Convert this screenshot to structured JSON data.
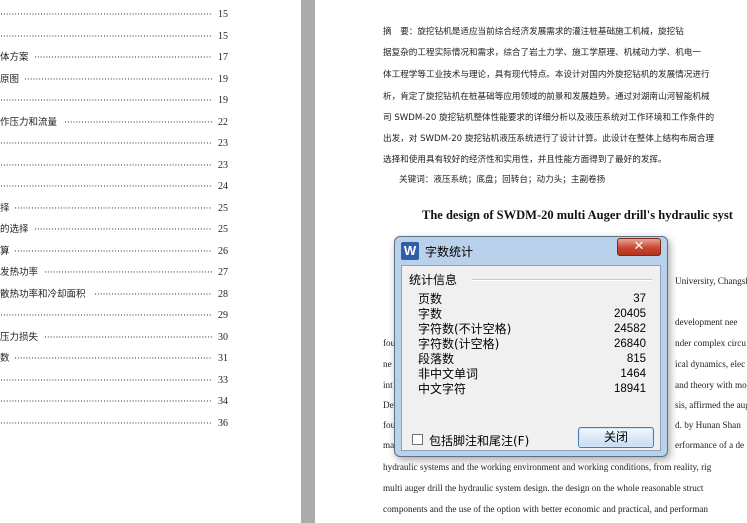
{
  "toc": [
    {
      "label": "",
      "page": "15"
    },
    {
      "label": "",
      "page": "15"
    },
    {
      "label": "体方案",
      "page": "17"
    },
    {
      "label": "原图",
      "page": "19"
    },
    {
      "label": "",
      "page": "19"
    },
    {
      "label": "作压力和流量",
      "page": "22"
    },
    {
      "label": "",
      "page": "23"
    },
    {
      "label": "",
      "page": "23"
    },
    {
      "label": "",
      "page": "24"
    },
    {
      "label": "择",
      "page": "25"
    },
    {
      "label": "的选择",
      "page": "25"
    },
    {
      "label": "算",
      "page": "26"
    },
    {
      "label": "发热功率",
      "page": "27"
    },
    {
      "label": "散热功率和冷却面积",
      "page": "28"
    },
    {
      "label": "",
      "page": "29"
    },
    {
      "label": "压力损失",
      "page": "30"
    },
    {
      "label": "数",
      "page": "31"
    },
    {
      "label": "",
      "page": "33"
    },
    {
      "label": "",
      "page": "34"
    },
    {
      "label": "",
      "page": "36"
    }
  ],
  "abstract_cn": [
    "摘　要：旋挖钻机是适应当前综合经济发展需求的灌注桩基础施工机械，旋挖钻",
    "据复杂的工程实际情况和需求，综合了岩土力学、施工学原理、机械动力学、机电一",
    "体工程学等工业技术与理论，具有现代特点。本设计对国内外旋挖钻机的发展情况进行",
    "析，肯定了旋挖钻机在桩基础等应用领域的前景和发展趋势。通过对湖南山河智能机械",
    "司 SWDM-20 旋挖钻机整体性能要求的详细分析以及液压系统对工作环境和工作条件的",
    "出发，对 SWDM-20 旋挖钻机液压系统进行了设计计算。此设计在整体上结构布局合理",
    "选择和使用具有较好的经济性和实用性，并且性能方面得到了最好的发挥。"
  ],
  "keywords_cn": "关键词：液压系统；底盘；回转台；动力头；主副卷扬",
  "title_en": "The design of SWDM-20 multi Auger drill's hydraulic syst",
  "abstract_en_right_fragments": [
    "University, Changsh",
    "development nee",
    "nder complex circu",
    "ical dynamics, elec",
    "and theory with mo",
    "sis, affirmed the aug",
    "d. by Hunan Shan",
    "erformance of a de"
  ],
  "abstract_en_left_fragments": [
    "fou",
    "ne",
    "int",
    "De",
    "fou",
    "ma"
  ],
  "abstract_en_bottom": [
    "hydraulic systems and the working environment and working conditions, from reality, rig",
    "multi auger drill the hydraulic system design. the design on the whole reasonable struct",
    "components and the use of the option with better economic and practical, and performan"
  ],
  "dialog": {
    "icon_letter": "W",
    "title": "字数统计",
    "close_glyph": "✕",
    "section_label": "统计信息",
    "stats": [
      {
        "label": "页数",
        "value": "37"
      },
      {
        "label": "字数",
        "value": "20405"
      },
      {
        "label": "字符数(不计空格)",
        "value": "24582"
      },
      {
        "label": "字符数(计空格)",
        "value": "26840"
      },
      {
        "label": "段落数",
        "value": "815"
      },
      {
        "label": "非中文单词",
        "value": "1464"
      },
      {
        "label": "中文字符",
        "value": "18941"
      }
    ],
    "checkbox_label": "包括脚注和尾注(F)",
    "checkbox_checked": false,
    "ok_label": "关闭"
  },
  "colors": {
    "dialog_frame": "#b9d1ea",
    "close_red": "#c8482f",
    "word_icon": "#2f5ea8"
  }
}
